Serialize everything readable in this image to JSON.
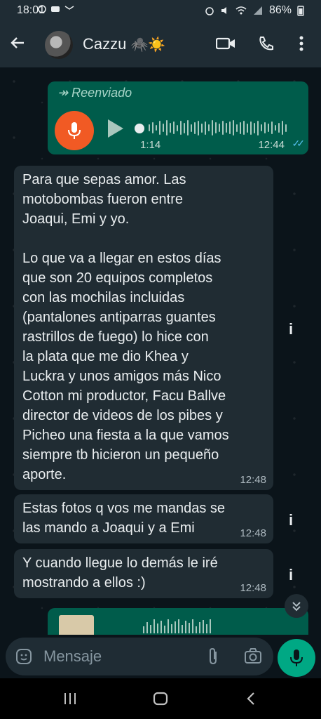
{
  "status": {
    "time": "18:01",
    "battery": "86%",
    "left_icons": [
      "whatsapp-icon",
      "youtube-icon",
      "mail-icon"
    ],
    "right_icons": [
      "alarm-icon",
      "mute-icon",
      "wifi-icon",
      "volte-icon",
      "signal-icon"
    ]
  },
  "header": {
    "contact_name": "Cazzu",
    "contact_emoji": "🕷️☀️"
  },
  "messages": {
    "voice1": {
      "forwarded_label": "Reenviado",
      "duration": "1:14",
      "time": "12:44",
      "ticks": "✓✓"
    },
    "m1": {
      "text": "Para que sepas amor. Las\nmotobombas fueron entre\nJoaqui, Emi y yo.\n\nLo que va a llegar en estos días\nque son 20 equipos completos\ncon las mochilas incluidas\n(pantalones antiparras guantes\nrastrillos de fuego) lo hice con\nla plata que me dio Khea y\nLuckra y unos amigos más Nico\nCotton mi productor, Facu Ballve\ndirector de videos de los pibes y\nPicheo una fiesta a la que vamos\nsiempre tb hicieron un pequeño\naporte.",
      "time": "12:48"
    },
    "m2": {
      "text": "Estas fotos q vos me mandas se\nlas mando a Joaqui y a Emi",
      "time": "12:48"
    },
    "m3": {
      "text": "Y cuando llegue lo demás le iré\nmostrando a ellos :)",
      "time": "12:48"
    },
    "info_glyph": "i"
  },
  "input": {
    "placeholder": "Mensaje"
  },
  "colors": {
    "outgoing": "#005c4b",
    "incoming": "#202c33",
    "accent": "#00a884",
    "mic_avatar": "#f15a24",
    "read_ticks": "#53bdeb"
  }
}
